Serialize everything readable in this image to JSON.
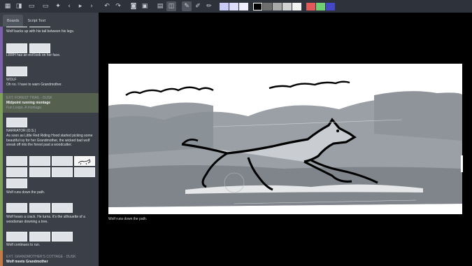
{
  "toolbar": {
    "swatches_light": [
      "#c9cbf7",
      "#dcddfb",
      "#eeeefd"
    ],
    "swatches_gray": [
      "#000000",
      "#6e6e6e",
      "#a8a8a8",
      "#d2d2d2",
      "#f2f2f2"
    ],
    "swatches_color": [
      "#e05a5a",
      "#6fcf73",
      "#4447c6"
    ]
  },
  "tabs": {
    "boards": "Boards",
    "script": "Script Text"
  },
  "sidebar": {
    "cap_backs_up": "Wolf backs up with his tail between his legs.",
    "cap_lrrh": "LRRH has an evil look on her face.",
    "cap_wolf_name": "WOLF",
    "cap_wolf_line": "Oh no. I have to warn Grandmother.",
    "scene1_slug": "EXT. FOREST TRAIL - DUSK",
    "scene1_title": "Midpoint running montage",
    "scene1_sub": "Fun Loops. A montage.",
    "narrator_name": "NARRATOR (O.S.)",
    "narrator_line": "As soon as Little Red Riding Hood started picking some beautiful ivy for her Grandmother, the wicked bad wolf sneak off into the forest past a woodcutter.",
    "cap_wolf_runs": "Wolf runs down the path.",
    "cap_wolf_hears": "Wolf hears a crack. He turns. It's the silhouette of a woodsman downing a tree.",
    "cap_wolf_continues": "Wolf continues to run.",
    "scene2_slug": "EXT. GRANDMOTHER'S COTTAGE - DUSK",
    "scene2_title": "Wolf meets Grandmother"
  },
  "canvas": {
    "caption": "Wolf runs down the path."
  }
}
